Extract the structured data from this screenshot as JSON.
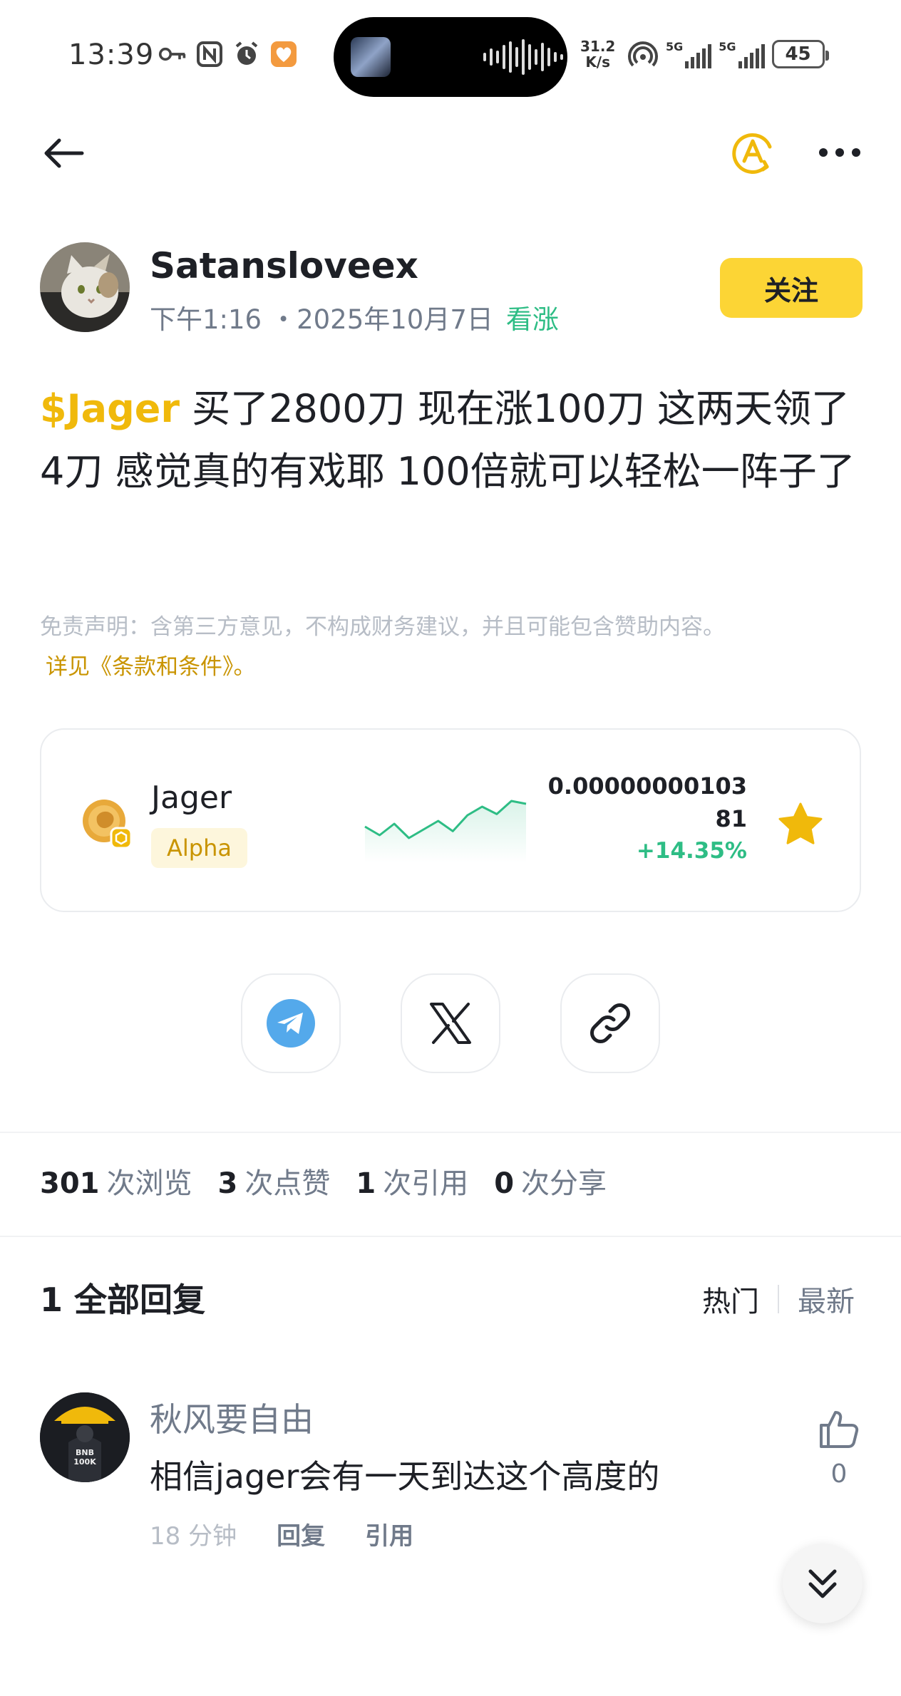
{
  "status_bar": {
    "time": "13:39",
    "net_speed_value": "31.2",
    "net_speed_unit": "K/s",
    "sim1": "5G",
    "sim2": "5G",
    "battery": "45"
  },
  "post": {
    "author": "Satansloveex",
    "time": "下午1:16",
    "date": "・2025年10月7日",
    "sentiment": "看涨",
    "follow_label": "关注",
    "cashtag": "$Jager",
    "body": " 买了2800刀 现在涨100刀 这两天领了4刀 感觉真的有戏耶 100倍就可以轻松一阵子了",
    "disclaimer": "免责声明：含第三方意见，不构成财务建议，并且可能包含赞助内容。",
    "terms_link": "详见《条款和条件》。"
  },
  "token": {
    "name": "Jager",
    "badge": "Alpha",
    "price": "0.0000000010381",
    "change": "+14.35%",
    "favorited": true,
    "sparkline_trend": [
      0.5,
      0.35,
      0.55,
      0.3,
      0.45,
      0.6,
      0.42,
      0.7,
      0.85,
      0.72,
      0.95,
      0.9
    ]
  },
  "stats": {
    "views_count": "301",
    "views_label": "次浏览",
    "likes_count": "3",
    "likes_label": "次点赞",
    "quotes_count": "1",
    "quotes_label": "次引用",
    "shares_count": "0",
    "shares_label": "次分享"
  },
  "replies": {
    "title": "1 全部回复",
    "sort_hot": "热门",
    "sort_newest": "最新",
    "items": [
      {
        "name": "秋风要自由",
        "text": "相信jager会有一天到达这个高度的",
        "time": "18 分钟",
        "reply_label": "回复",
        "quote_label": "引用",
        "likes": "0"
      }
    ]
  },
  "colors": {
    "brand_yellow": "#FCD535",
    "accent_gold": "#F0B90B",
    "up_green": "#2EBD85",
    "telegram_blue": "#54A9EB"
  }
}
